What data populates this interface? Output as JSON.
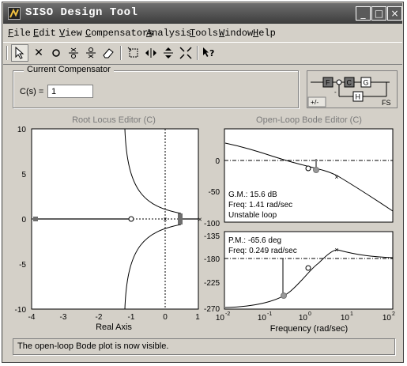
{
  "window": {
    "title": "SISO Design Tool",
    "controls": [
      "_",
      "□",
      "×"
    ]
  },
  "menubar": [
    {
      "accel": "F",
      "rest": "ile"
    },
    {
      "accel": "E",
      "rest": "dit"
    },
    {
      "accel": "V",
      "rest": "iew"
    },
    {
      "accel": "C",
      "rest": "ompensators"
    },
    {
      "accel": "A",
      "rest": "nalysis"
    },
    {
      "accel": "T",
      "rest": "ools"
    },
    {
      "accel": "W",
      "rest": "indow"
    },
    {
      "accel": "H",
      "rest": "elp"
    }
  ],
  "toolbar": {
    "icons": [
      "pointer-icon",
      "add-pole-icon",
      "add-zero-icon",
      "add-lead-icon",
      "add-lag-icon",
      "eraser-icon",
      "zoom-xy-icon",
      "zoom-x-icon",
      "zoom-y-icon",
      "fit-icon",
      "whats-this-icon"
    ]
  },
  "compensator": {
    "legend": "Current Compensator",
    "label": "C(s) =",
    "value": "1"
  },
  "diagram": {
    "blocks": [
      "F",
      "C",
      "G",
      "H"
    ],
    "sign_button": "+/-",
    "config_button": "FS"
  },
  "root_locus": {
    "title": "Root Locus Editor (C)",
    "xlabel": "Real Axis",
    "xticks": [
      "-4",
      "-3",
      "-2",
      "-1",
      "0",
      "1"
    ],
    "yticks": [
      "10",
      "5",
      "0",
      "-5",
      "-10"
    ],
    "xlim": [
      -4,
      1.3
    ],
    "ylim": [
      -10,
      10
    ]
  },
  "bode": {
    "title": "Open-Loop Bode Editor (C)",
    "xlabel": "Frequency (rad/sec)",
    "mag": {
      "yticks": [
        "0",
        "-50",
        "-100"
      ],
      "ylim": [
        -100,
        40
      ],
      "gm": "G.M.: 15.6 dB",
      "gm_freq": "Freq: 1.41 rad/sec",
      "stability": "Unstable loop"
    },
    "phase": {
      "yticks": [
        "-135",
        "-180",
        "-225",
        "-270"
      ],
      "ylim": [
        -270,
        -120
      ],
      "pm": "P.M.: -65.6 deg",
      "pm_freq": "Freq: 0.249 rad/sec"
    },
    "xticks": [
      {
        "base": "10",
        "exp": "-2"
      },
      {
        "base": "10",
        "exp": "-1"
      },
      {
        "base": "10",
        "exp": "0"
      },
      {
        "base": "10",
        "exp": "1"
      },
      {
        "base": "10",
        "exp": "2"
      }
    ],
    "xlim_log10": [
      -2,
      2
    ]
  },
  "status": "The open-loop Bode plot is now visible.",
  "colors": {
    "plot_title": "#7a7a7a",
    "marker": "#6e6e6e",
    "titlebar": "#4a4a4a"
  }
}
